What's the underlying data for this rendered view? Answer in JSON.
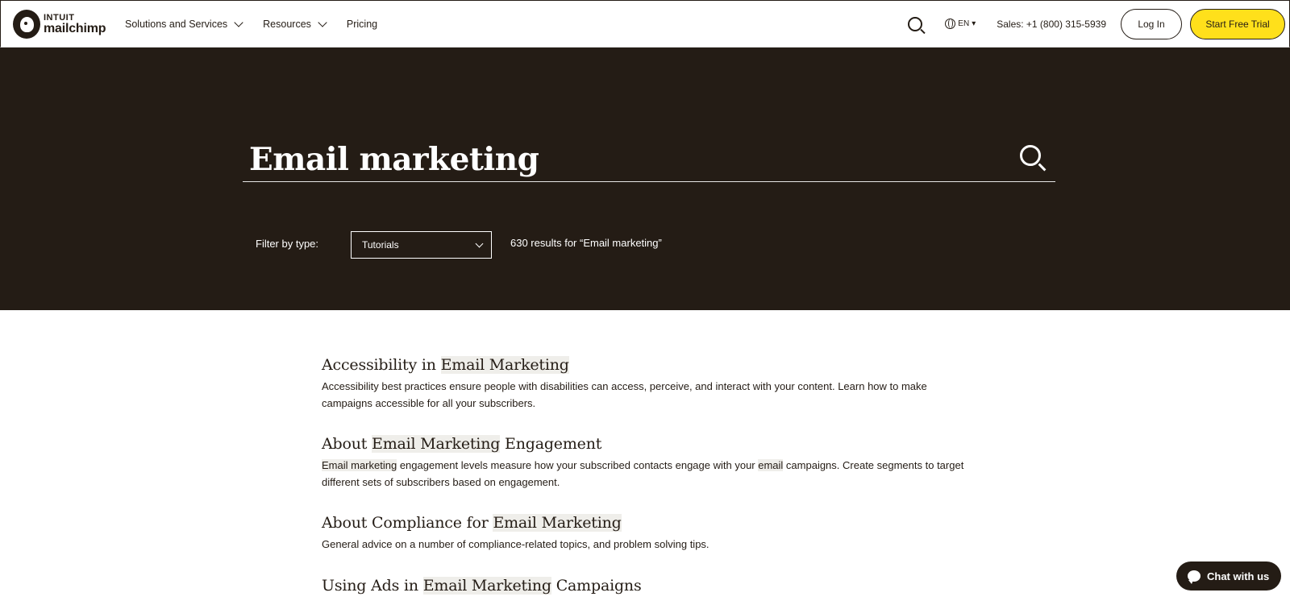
{
  "header": {
    "logo_top": "INTUIT",
    "logo_bottom": "mailchimp",
    "nav": [
      {
        "label": "Solutions and Services",
        "has_chevron": true
      },
      {
        "label": "Resources",
        "has_chevron": true
      },
      {
        "label": "Pricing",
        "has_chevron": false
      }
    ],
    "lang": "EN",
    "sales": "Sales: +1 (800) 315-5939",
    "login_label": "Log In",
    "trial_label": "Start Free Trial",
    "icons": [
      "search-icon",
      "globe-icon",
      "chevron-down-icon"
    ]
  },
  "hero": {
    "query": "Email marketing",
    "filter_label": "Filter by type:",
    "filter_value": "Tutorials",
    "results_count": "630 results for “Email marketing”"
  },
  "results": [
    {
      "title_parts": [
        [
          "Accessibility in ",
          false
        ],
        [
          "Email Marketing",
          true
        ]
      ],
      "desc_parts": [
        [
          "Accessibility best practices ensure people with disabilities can access, perceive, and interact with your content. Learn how to make campaigns accessible for all your subscribers.",
          false
        ]
      ]
    },
    {
      "title_parts": [
        [
          "About ",
          false
        ],
        [
          "Email Marketing",
          true
        ],
        [
          " Engagement",
          false
        ]
      ],
      "desc_parts": [
        [
          "Email marketing",
          true
        ],
        [
          " engagement levels measure how your subscribed contacts engage with your ",
          false
        ],
        [
          "email",
          true
        ],
        [
          " campaigns. Create segments to target different sets of subscribers based on engagement.",
          false
        ]
      ]
    },
    {
      "title_parts": [
        [
          "About Compliance for ",
          false
        ],
        [
          "Email Marketing",
          true
        ]
      ],
      "desc_parts": [
        [
          "General advice on a number of compliance-related topics, and problem solving tips.",
          false
        ]
      ]
    },
    {
      "title_parts": [
        [
          "Using Ads in ",
          false
        ],
        [
          "Email Marketing",
          true
        ],
        [
          " Campaigns",
          false
        ]
      ],
      "desc_parts": []
    }
  ],
  "chat": {
    "label": "Chat with us"
  },
  "colors": {
    "dark": "#241c15",
    "yellow": "#ffe01b",
    "highlight": "#efeeea"
  }
}
